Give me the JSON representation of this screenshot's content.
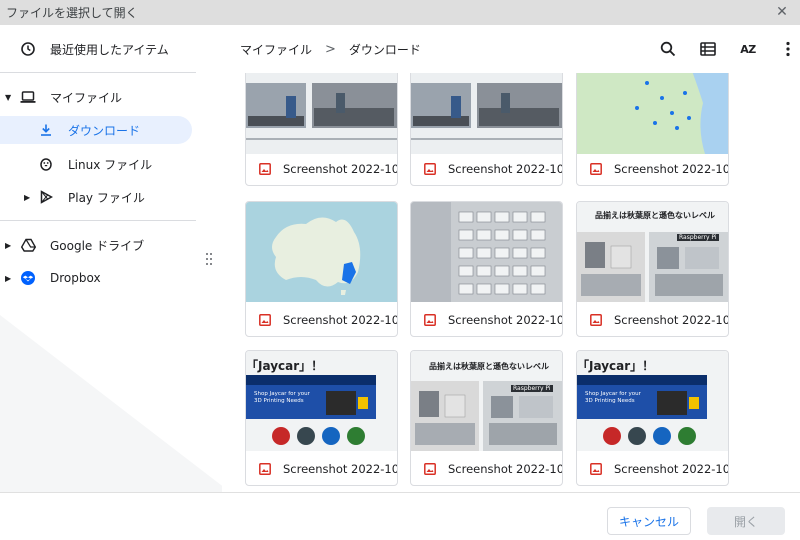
{
  "window": {
    "title": "ファイルを選択して開く",
    "close_icon": "close-icon"
  },
  "sidebar": {
    "recent": "最近使用したアイテム",
    "my_files": "マイファイル",
    "downloads": "ダウンロード",
    "linux": "Linux ファイル",
    "play": "Play ファイル",
    "google_drive": "Google ドライブ",
    "dropbox": "Dropbox"
  },
  "breadcrumb": {
    "root": "マイファイル",
    "current": "ダウンロード",
    "separator": ">"
  },
  "toolbar": {
    "sort_label": "AZ"
  },
  "files": [
    {
      "name": "Screenshot 2022-10..."
    },
    {
      "name": "Screenshot 2022-10..."
    },
    {
      "name": "Screenshot 2022-10..."
    },
    {
      "name": "Screenshot 2022-10..."
    },
    {
      "name": "Screenshot 2022-10..."
    },
    {
      "name": "Screenshot 2022-10..."
    },
    {
      "name": "Screenshot 2022-10..."
    },
    {
      "name": "Screenshot 2022-10..."
    },
    {
      "name": "Screenshot 2022-10..."
    }
  ],
  "thumb_text": {
    "jaycar_title": "「Jaycar」！",
    "jaycar_promo_1": "Shop Jaycar for your",
    "jaycar_promo_2": "3D Printing Needs",
    "poster_title": "品揃えは秋葉原と遜色ないレベル",
    "raspberry": "Raspberry Pi"
  },
  "buttons": {
    "cancel": "キャンセル",
    "open": "開く"
  },
  "colors": {
    "accent": "#1a73e8",
    "active_bg": "#e8f0fe",
    "image_icon": "#d93025",
    "dropbox": "#0061fe"
  }
}
